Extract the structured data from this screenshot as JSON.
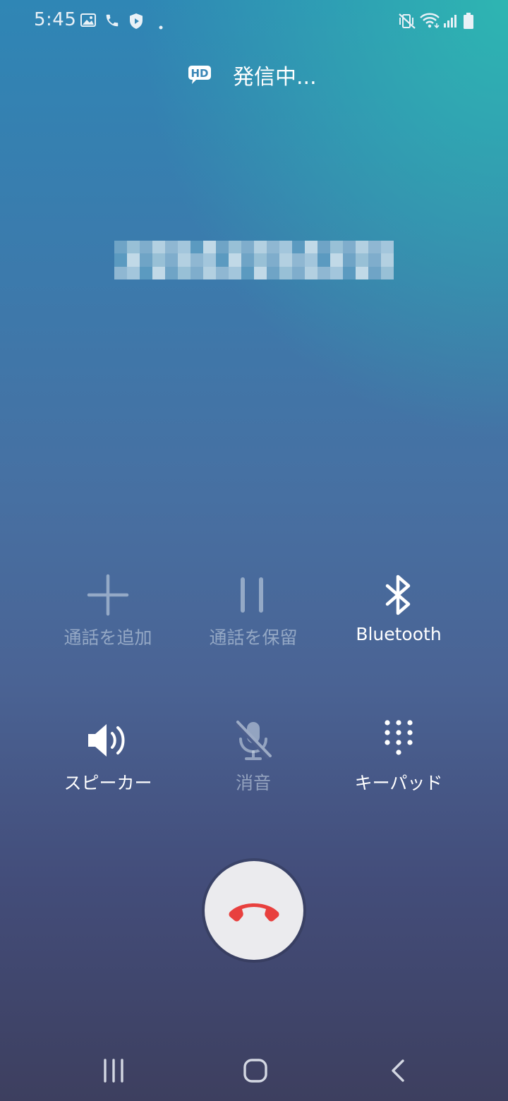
{
  "status_bar": {
    "time": "5:45",
    "left_icons": [
      "gallery-icon",
      "phone-icon",
      "shield-icon",
      "dot-icon"
    ],
    "right_icons": [
      "vibrate-icon",
      "wifi-icon",
      "signal-icon",
      "battery-icon"
    ]
  },
  "call": {
    "hd_label": "HD",
    "status": "発信中..."
  },
  "controls": [
    {
      "id": "add-call",
      "label": "通話を追加",
      "icon": "plus-icon",
      "enabled": false
    },
    {
      "id": "hold-call",
      "label": "通話を保留",
      "icon": "pause-icon",
      "enabled": false
    },
    {
      "id": "bluetooth",
      "label": "Bluetooth",
      "icon": "bluetooth-icon",
      "enabled": true
    },
    {
      "id": "speaker",
      "label": "スピーカー",
      "icon": "speaker-icon",
      "enabled": true
    },
    {
      "id": "mute",
      "label": "消音",
      "icon": "mic-off-icon",
      "enabled": false
    },
    {
      "id": "keypad",
      "label": "キーパッド",
      "icon": "keypad-icon",
      "enabled": true
    }
  ],
  "colors": {
    "end_call_red": "#e8403e",
    "end_call_bg": "#ebebee",
    "accent_teal": "#2eb8b2"
  },
  "nav_bar": {
    "items": [
      "recents-icon",
      "home-icon",
      "back-icon"
    ]
  }
}
